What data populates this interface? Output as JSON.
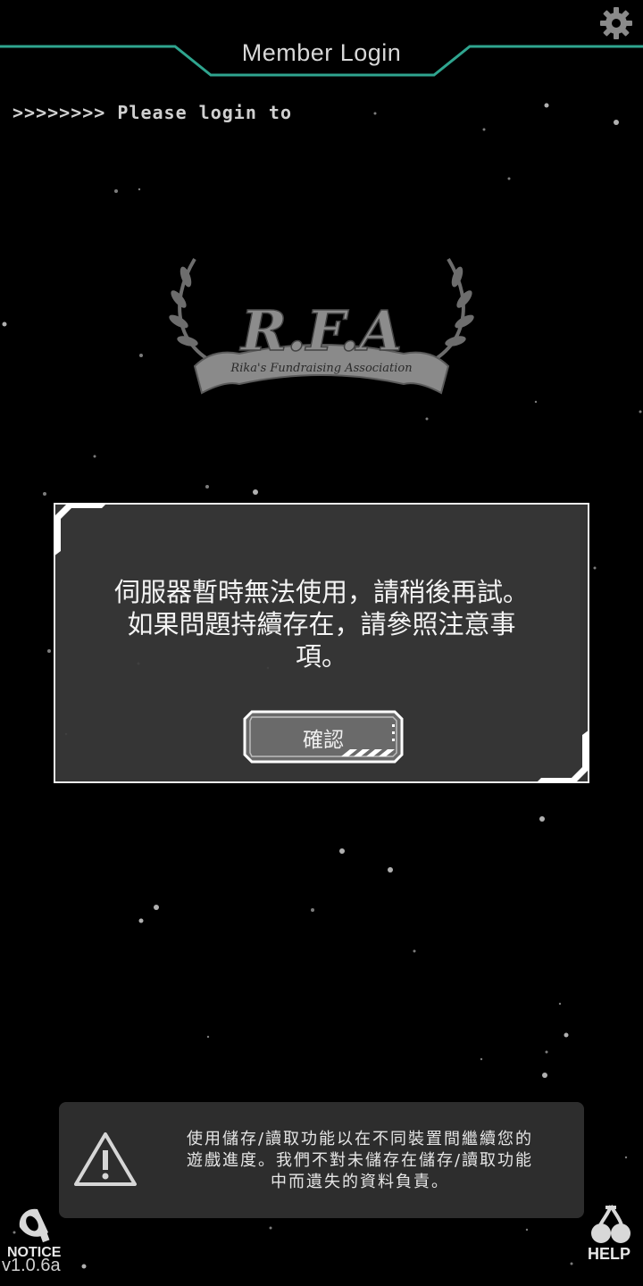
{
  "header": {
    "title": "Member Login",
    "settings_icon": "gear-icon"
  },
  "marquee": {
    "text": ">>>>>>>> Please login to"
  },
  "logo": {
    "title": "R.F.A",
    "subtitle": "Rika's Fundraising Association"
  },
  "dialog": {
    "message_line1": "伺服器暫時無法使用，請稍後再試。",
    "message_line2": "如果問題持續存在，請參照注意事",
    "message_line3": "項。",
    "confirm_label": "確認"
  },
  "notice_box": {
    "icon": "warning-icon",
    "line1": "使用儲存/讀取功能以在不同裝置間繼續您的",
    "line2": "遊戲進度。我們不對未儲存在儲存/讀取功能",
    "line3": "中而遺失的資料負責。"
  },
  "footer": {
    "notice_label": "NOTICE",
    "notice_icon": "megaphone-icon",
    "version": "v1.0.6a",
    "help_label": "HELP",
    "help_icon": "cherry-icon"
  },
  "colors": {
    "background": "#000000",
    "accent_teal": "#2fa58f",
    "dialog_bg": "#3a3a3a",
    "notice_bg": "#2d2d2d"
  }
}
